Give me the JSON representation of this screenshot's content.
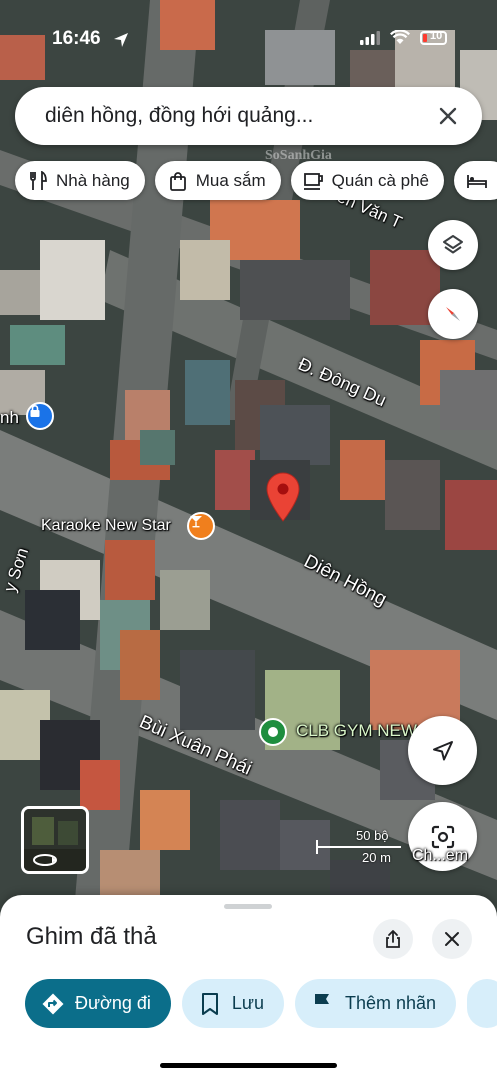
{
  "status_bar": {
    "time": "16:46",
    "battery": "10"
  },
  "search": {
    "query": "diên hồng, đồng hới quảng..."
  },
  "chips": [
    {
      "label": "Nhà hàng",
      "icon": "fork-knife-icon"
    },
    {
      "label": "Mua sắm",
      "icon": "shopping-bag-icon"
    },
    {
      "label": "Quán cà phê",
      "icon": "coffee-cup-icon"
    },
    {
      "label": "",
      "icon": "bed-icon"
    }
  ],
  "map": {
    "streets": {
      "dong_du": "Đ. Đông Du",
      "dien_hong": "Diên Hồng",
      "bui_xuan_phai": "Bùi Xuân Phái",
      "nguyen_van_t": "ễn Văn T",
      "son": "y Sơn",
      "nh": "nh"
    },
    "places": {
      "karaoke": "Karaoke New Star",
      "gym": "CLB GYM NEW"
    },
    "watermark": "SoSanhGia",
    "scale": {
      "top": "50 bộ",
      "bottom": "20 m"
    },
    "lens_label": "Ch...em"
  },
  "sheet": {
    "title": "Ghim đã thả",
    "actions": [
      {
        "label": "Đường đi",
        "icon": "directions-icon"
      },
      {
        "label": "Lưu",
        "icon": "bookmark-icon"
      },
      {
        "label": "Thêm nhãn",
        "icon": "flag-icon"
      }
    ]
  },
  "colors": {
    "accent": "#0b6e8a",
    "pin": "#ea4335",
    "chip_tonal": "#d7eefa",
    "karaoke_marker": "#f07f1d",
    "gym_marker": "#1e8e3e"
  }
}
